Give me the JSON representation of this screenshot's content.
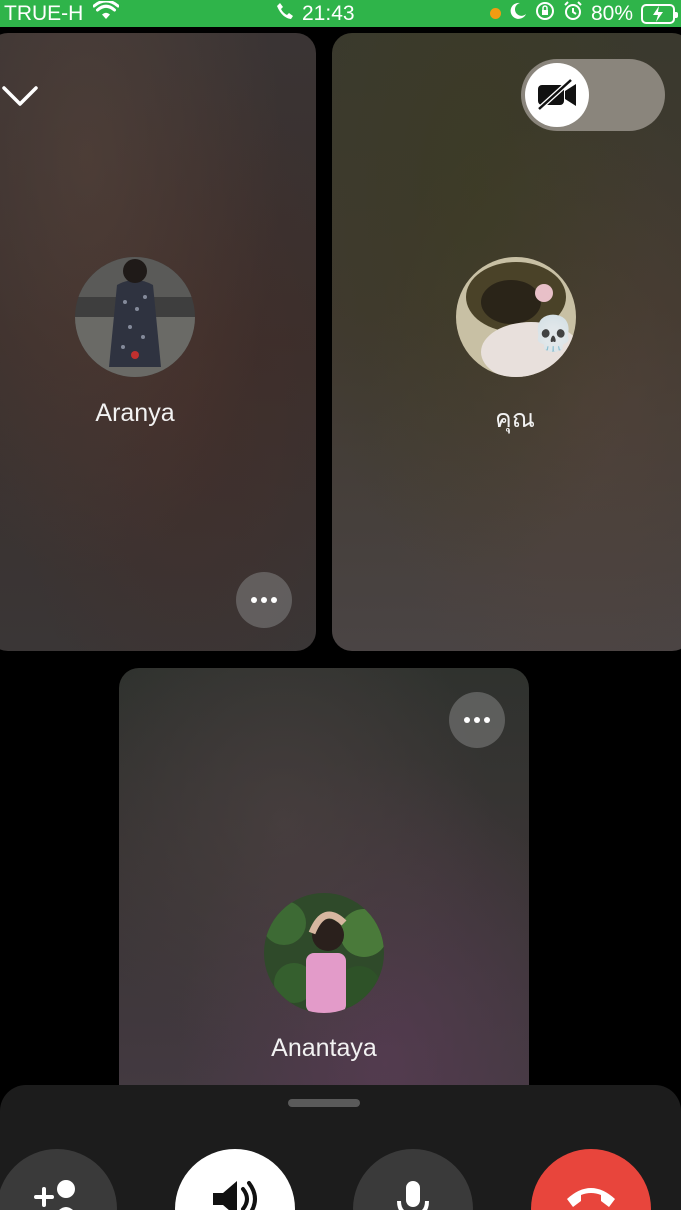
{
  "status_bar": {
    "carrier": "TRUE-H",
    "time": "21:43",
    "battery": "80%",
    "color": "#2fb44a",
    "icons": [
      "wifi-icon",
      "phone-icon",
      "moon-icon",
      "orientation-lock-icon",
      "alarm-icon",
      "battery-charging-icon"
    ]
  },
  "participants": [
    {
      "name": "Aranya",
      "avatar": "aranya-avatar"
    },
    {
      "name": "คุณ",
      "avatar": "self-avatar",
      "badge": "💀"
    },
    {
      "name": "Anantaya",
      "avatar": "anantaya-avatar"
    }
  ],
  "controls": {
    "camera_toggle": "camera-off-icon",
    "buttons": [
      "add-person-icon",
      "speaker-icon",
      "microphone-icon",
      "end-call-icon"
    ],
    "end_call_color": "#e8453c"
  }
}
